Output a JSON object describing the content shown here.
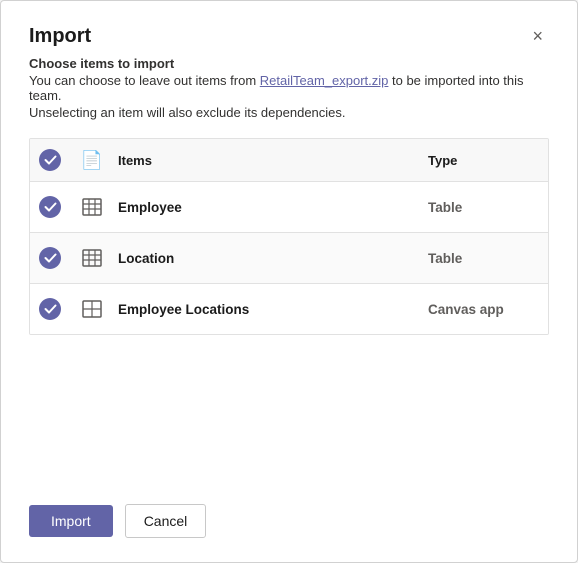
{
  "dialog": {
    "title": "Import",
    "close_label": "×",
    "subtitle": "Choose items to import",
    "description_part1": "You can choose to leave out items from ",
    "file_name": "RetailTeam_export.zip",
    "description_part2": " to be imported into this team.",
    "note": "Unselecting an item will also exclude its dependencies."
  },
  "table": {
    "columns": {
      "check": "",
      "icon": "",
      "items": "Items",
      "type": "Type"
    },
    "rows": [
      {
        "id": 1,
        "name": "Employee",
        "type": "Table",
        "checked": true,
        "icon": "table"
      },
      {
        "id": 2,
        "name": "Location",
        "type": "Table",
        "checked": true,
        "icon": "table"
      },
      {
        "id": 3,
        "name": "Employee Locations",
        "type": "Canvas app",
        "checked": true,
        "icon": "canvas"
      }
    ]
  },
  "footer": {
    "import_label": "Import",
    "cancel_label": "Cancel"
  }
}
